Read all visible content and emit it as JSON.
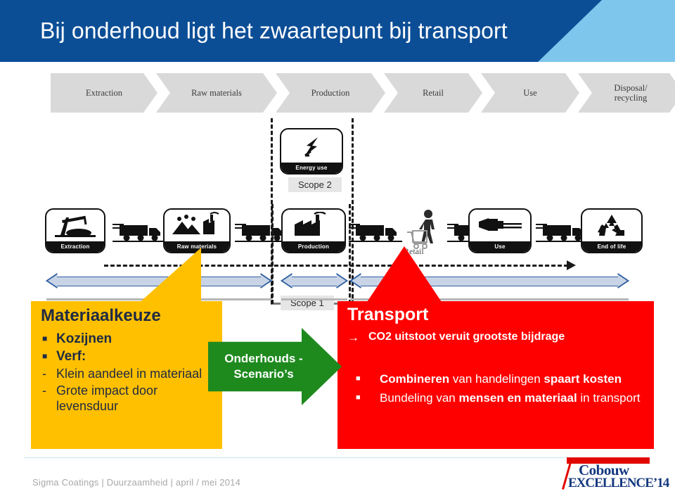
{
  "slide": {
    "title": "Bij onderhoud ligt het zwaartepunt bij transport",
    "colors": {
      "header_blue": "#0c4e96",
      "header_accent": "#7ec6ec",
      "yellow": "#FFC000",
      "red": "#FF0000",
      "green": "#1e8a1e",
      "chevron_gray": "#d9d9d9",
      "arrow_blue_fill": "#c8d4e6",
      "arrow_blue_line": "#2f5fa0"
    }
  },
  "lifecycle_chevrons": [
    {
      "label": "Extraction"
    },
    {
      "label": "Raw materials"
    },
    {
      "label": "Production"
    },
    {
      "label": "Retail"
    },
    {
      "label": "Use"
    },
    {
      "label": "Disposal/",
      "label2": "recycling"
    }
  ],
  "scopes": {
    "scope2_label": "Scope 2",
    "scope1_label": "Scope 1"
  },
  "energy_card": {
    "caption": "Energy use",
    "icon": "lightning-bolt-icon"
  },
  "stage_icons": [
    {
      "caption": "Extraction",
      "icon": "oil-pump-icon"
    },
    {
      "caption": "Raw materials",
      "icon": "quarry-factory-icon"
    },
    {
      "caption": "Production",
      "icon": "factory-icon"
    },
    {
      "caption": "Use",
      "icon": "paint-brush-icon"
    },
    {
      "caption": "End of life",
      "icon": "recycle-icon"
    }
  ],
  "retail": {
    "label": "Retail",
    "icon": "shopper-cart-icon"
  },
  "transport_icons": [
    {
      "icon": "truck-icon"
    },
    {
      "icon": "truck-icon"
    },
    {
      "icon": "truck-icon"
    },
    {
      "icon": "truck-icon"
    },
    {
      "icon": "truck-icon"
    },
    {
      "icon": "truck-icon"
    }
  ],
  "yellow_callout": {
    "heading": "Materiaalkeuze",
    "items": [
      {
        "marker": "square",
        "text": "Kozijnen"
      },
      {
        "marker": "square",
        "text": "Verf:"
      },
      {
        "marker": "dash",
        "text": "Klein aandeel in materiaal"
      },
      {
        "marker": "dash",
        "text": "Grote impact door levensduur"
      }
    ]
  },
  "green_arrow": {
    "line1": "Onderhouds -",
    "line2": "Scenario’s"
  },
  "red_callout": {
    "heading": "Transport",
    "arrow_marker": "→",
    "arrow_text": "CO2 uitstoot veruit grootste bijdrage",
    "items": [
      {
        "marker": "square",
        "parts": [
          {
            "text": "Combineren ",
            "bold": true
          },
          {
            "text": "van handelingen ",
            "bold": false
          },
          {
            "text": "spaart kosten",
            "bold": true
          }
        ]
      },
      {
        "marker": "square",
        "parts": [
          {
            "text": "Bundeling van ",
            "bold": false
          },
          {
            "text": "mensen en materiaal ",
            "bold": true
          },
          {
            "text": "in transport",
            "bold": false
          }
        ]
      }
    ]
  },
  "footer": {
    "text": "Sigma Coatings | Duurzaamheid | april / mei 2014"
  },
  "logo": {
    "word1": "Cobouw",
    "word2": "EXCELLENCE’14"
  }
}
